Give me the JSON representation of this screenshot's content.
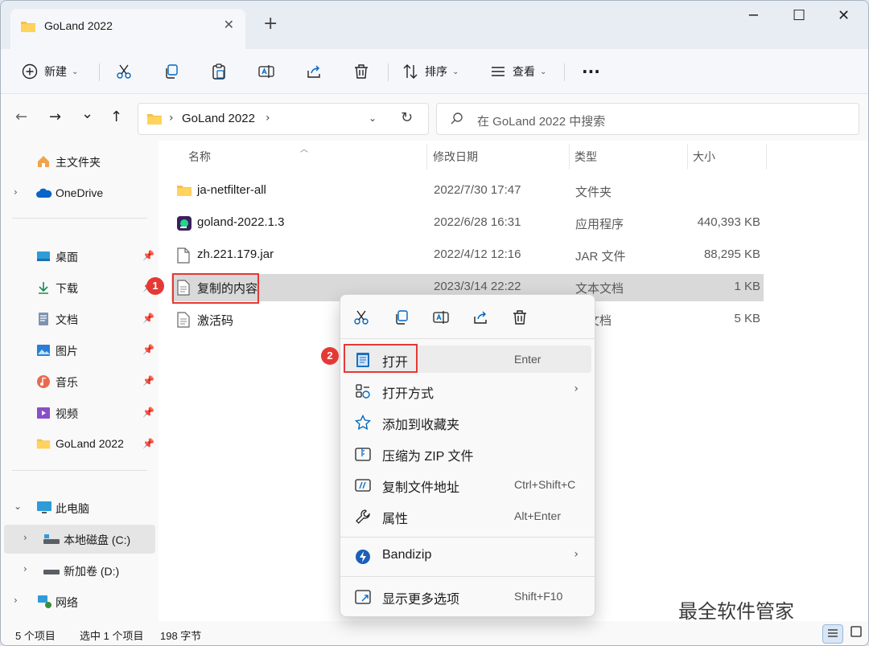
{
  "window": {
    "tab_title": "GoLand 2022",
    "tab_close": "✕",
    "new_tab": "+",
    "minimize": "─",
    "maximize": "☐",
    "close": "✕"
  },
  "toolbar": {
    "new_label": "新建",
    "sort_label": "排序",
    "view_label": "查看",
    "more": "···"
  },
  "nav": {
    "back": "←",
    "forward": "→",
    "recent": "⌄",
    "up": "↑",
    "breadcrumb": "GoLand 2022",
    "breadcrumb_sep": "›",
    "refresh": "↻",
    "search_placeholder": "在 GoLand 2022 中搜索"
  },
  "sidebar": {
    "items": [
      {
        "label": "主文件夹"
      },
      {
        "label": "OneDrive"
      },
      {
        "label": "桌面"
      },
      {
        "label": "下载"
      },
      {
        "label": "文档"
      },
      {
        "label": "图片"
      },
      {
        "label": "音乐"
      },
      {
        "label": "视频"
      },
      {
        "label": "GoLand 2022"
      },
      {
        "label": "此电脑"
      },
      {
        "label": "本地磁盘 (C:)"
      },
      {
        "label": "新加卷 (D:)"
      },
      {
        "label": "网络"
      }
    ]
  },
  "columns": {
    "name": "名称",
    "date": "修改日期",
    "type": "类型",
    "size": "大小"
  },
  "files": [
    {
      "name": "ja-netfilter-all",
      "date": "2022/7/30 17:47",
      "type": "文件夹",
      "size": ""
    },
    {
      "name": "goland-2022.1.3",
      "date": "2022/6/28 16:31",
      "type": "应用程序",
      "size": "440,393 KB"
    },
    {
      "name": "zh.221.179.jar",
      "date": "2022/4/12 12:16",
      "type": "JAR 文件",
      "size": "88,295 KB"
    },
    {
      "name": "复制的内容",
      "date": "2023/3/14 22:22",
      "type": "文本文档",
      "size": "1 KB"
    },
    {
      "name": "激活码",
      "date": "",
      "type": "本文档",
      "size": "5 KB"
    }
  ],
  "badges": {
    "one": "1",
    "two": "2"
  },
  "context_menu": {
    "items": [
      {
        "label": "打开",
        "shortcut": "Enter"
      },
      {
        "label": "打开方式",
        "shortcut": ""
      },
      {
        "label": "添加到收藏夹",
        "shortcut": ""
      },
      {
        "label": "压缩为 ZIP 文件",
        "shortcut": ""
      },
      {
        "label": "复制文件地址",
        "shortcut": "Ctrl+Shift+C"
      },
      {
        "label": "属性",
        "shortcut": "Alt+Enter"
      },
      {
        "label": "Bandizip",
        "shortcut": ""
      },
      {
        "label": "显示更多选项",
        "shortcut": "Shift+F10"
      }
    ],
    "arrow": "›"
  },
  "status": {
    "count": "5 个项目",
    "selection": "选中 1 个项目",
    "size": "198 字节"
  },
  "watermark": "最全软件管家",
  "colors": {
    "accent": "#0067c0",
    "annotation_red": "#e53935",
    "folder": "#f4c04e"
  }
}
